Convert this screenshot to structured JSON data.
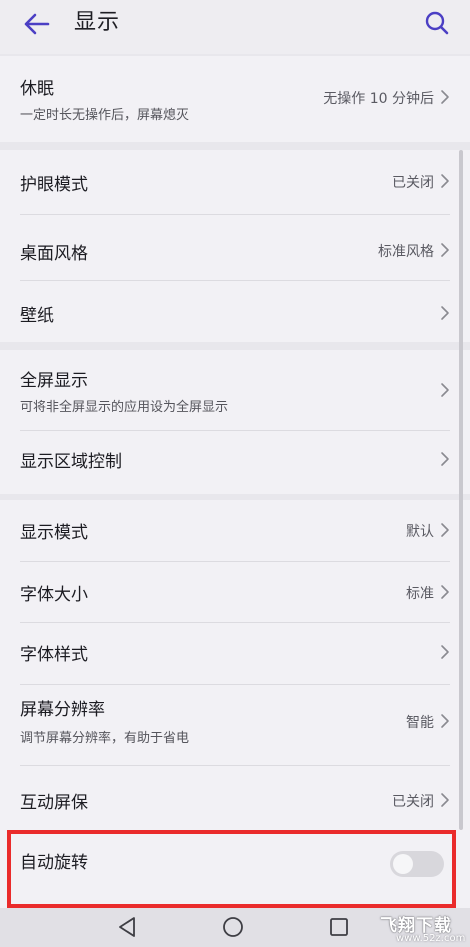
{
  "header": {
    "title": "显示",
    "back_icon": "arrow-left-icon",
    "search_icon": "search-icon",
    "accent_color": "#4b3fc4"
  },
  "settings": {
    "sleep": {
      "title": "休眠",
      "subtitle": "一定时长无操作后，屏幕熄灭",
      "value": "无操作 10 分钟后"
    },
    "eye_comfort": {
      "title": "护眼模式",
      "value": "已关闭"
    },
    "home_screen_style": {
      "title": "桌面风格",
      "value": "标准风格"
    },
    "wallpaper": {
      "title": "壁纸"
    },
    "full_screen_display": {
      "title": "全屏显示",
      "subtitle": "可将非全屏显示的应用设为全屏显示"
    },
    "display_area_control": {
      "title": "显示区域控制"
    },
    "display_mode": {
      "title": "显示模式",
      "value": "默认"
    },
    "font_size": {
      "title": "字体大小",
      "value": "标准"
    },
    "font_style": {
      "title": "字体样式"
    },
    "screen_resolution": {
      "title": "屏幕分辨率",
      "subtitle": "调节屏幕分辨率，有助于省电",
      "value": "智能"
    },
    "screensaver": {
      "title": "互动屏保",
      "value": "已关闭"
    },
    "auto_rotate": {
      "title": "自动旋转",
      "enabled": false
    }
  },
  "highlight_color": "#ea2b2b",
  "navbar": {
    "back_icon": "triangle-back-icon",
    "home_icon": "circle-home-icon",
    "recents_icon": "square-recents-icon"
  },
  "watermark": {
    "main": "飞翔下载",
    "sub": "www.52z.com"
  }
}
